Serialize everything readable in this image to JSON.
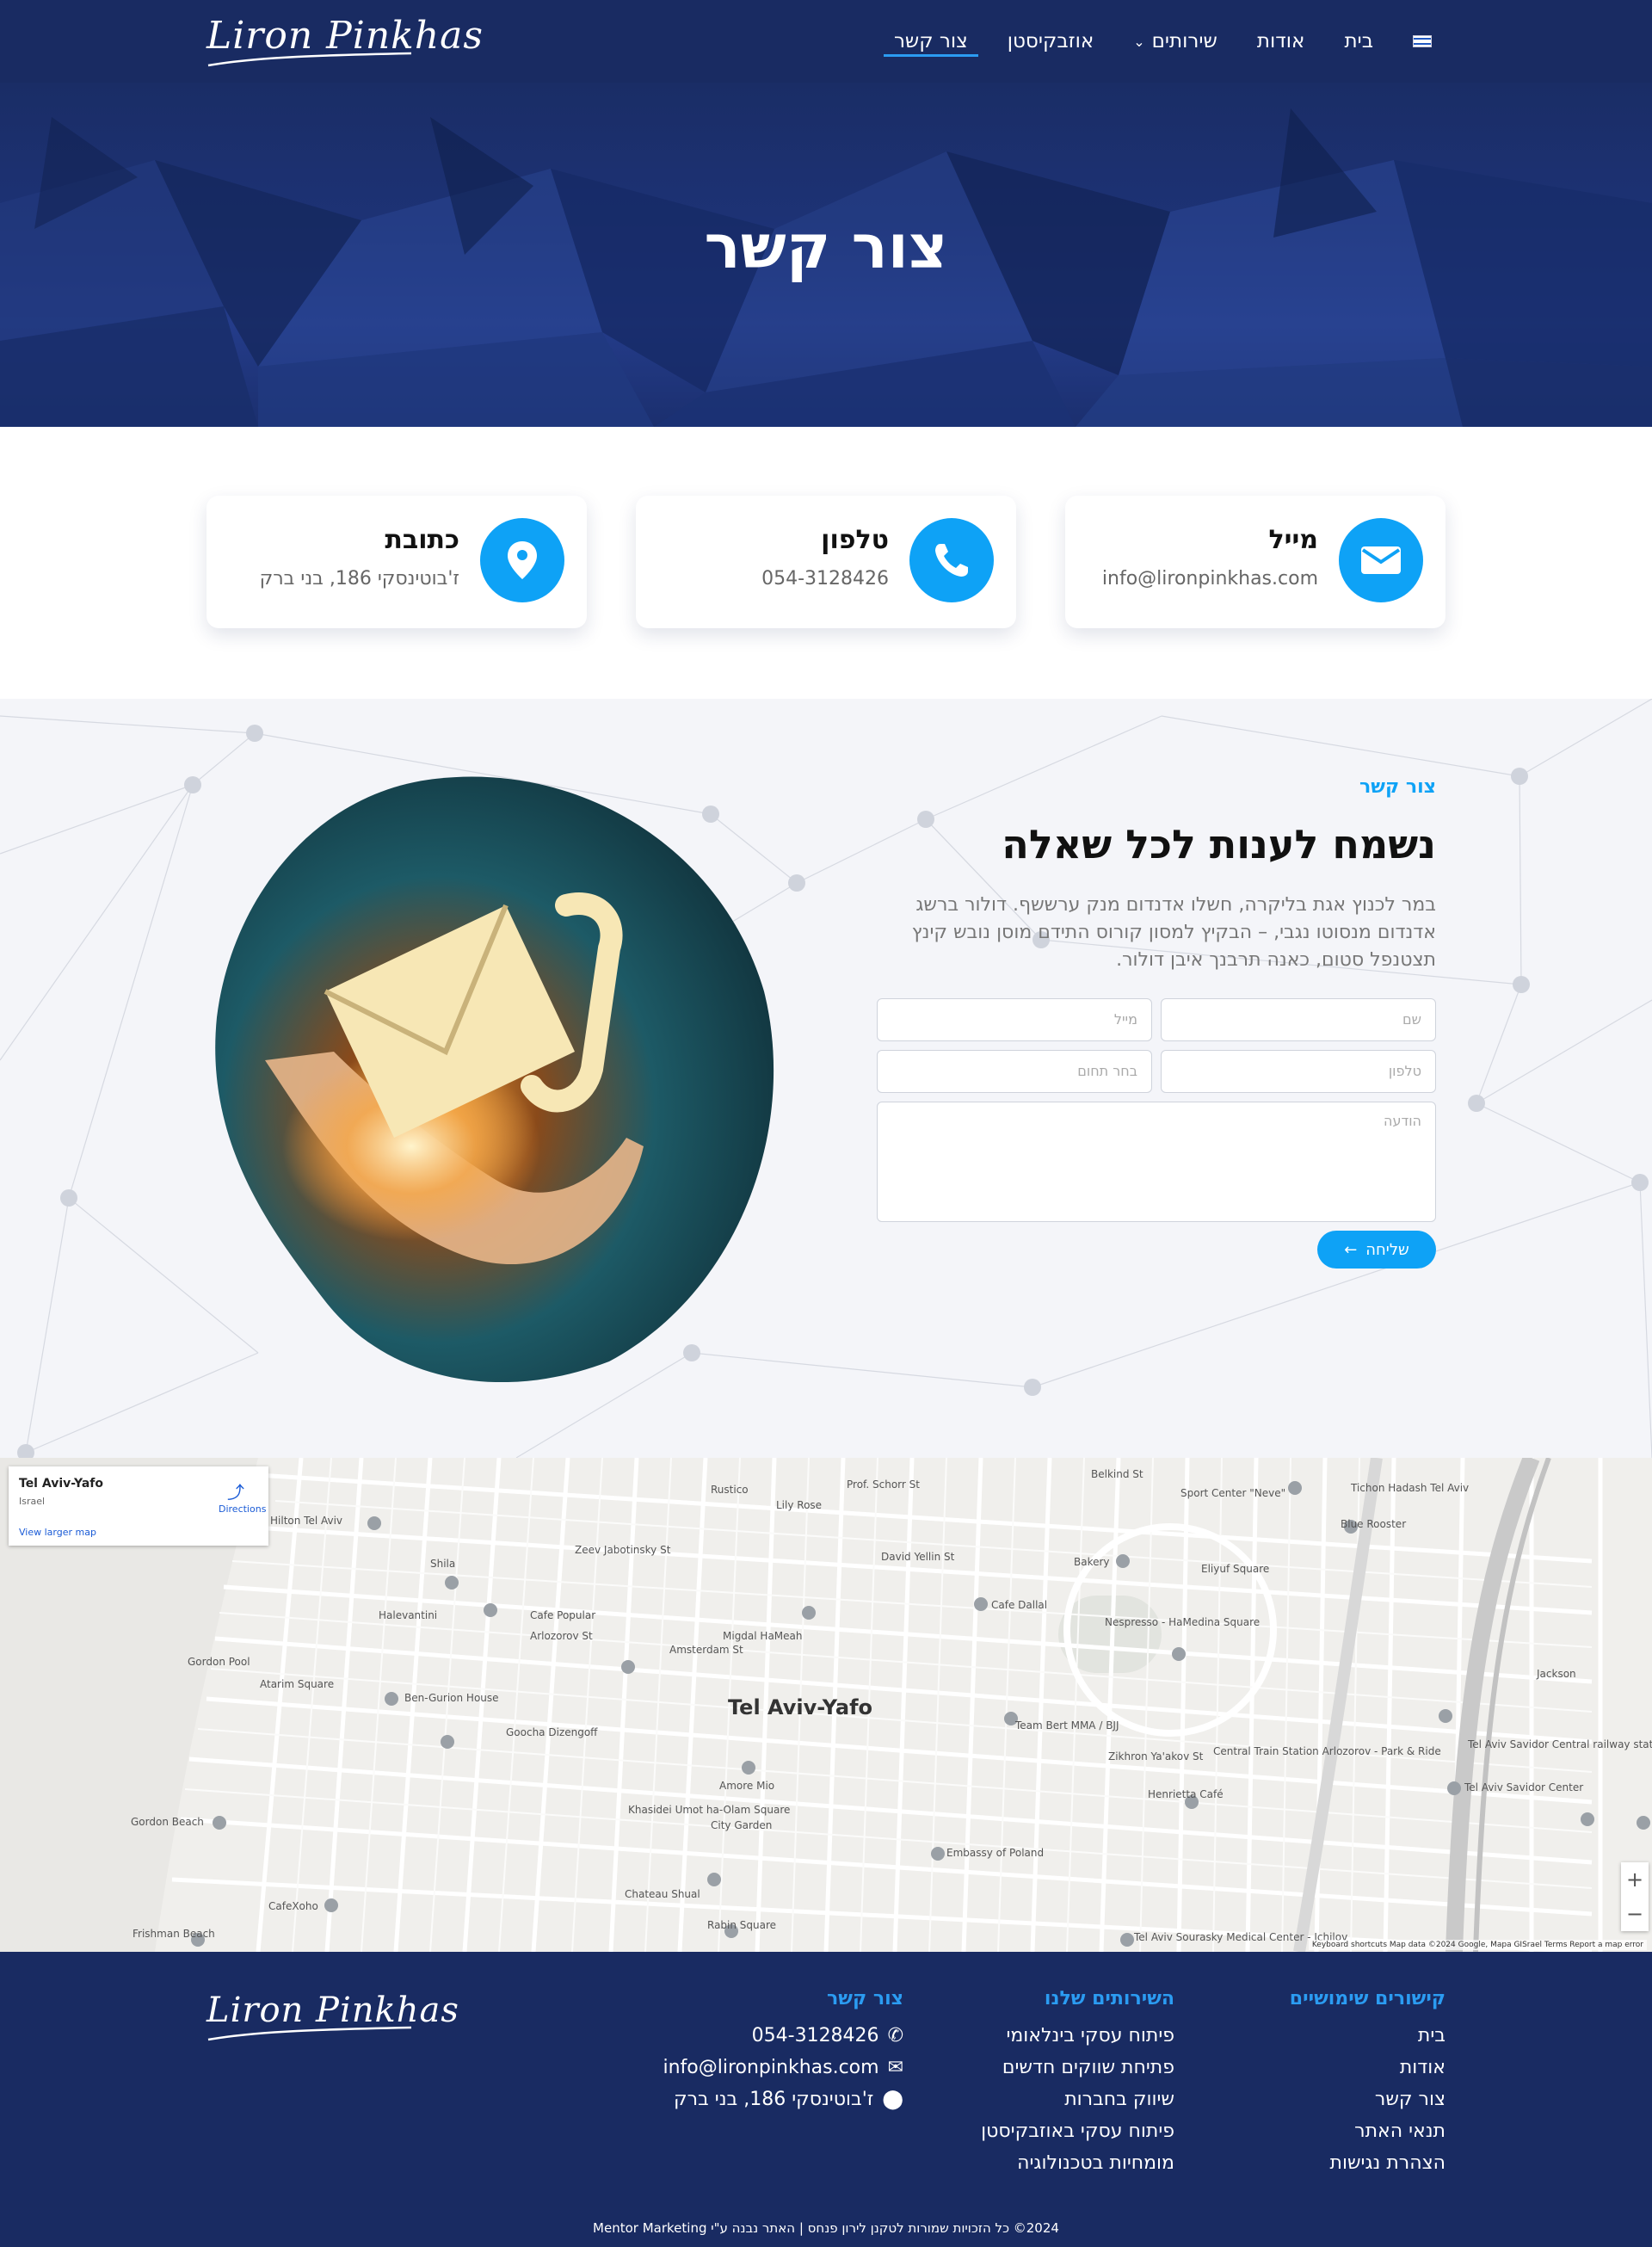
{
  "header": {
    "logo": "Liron Pinkhas",
    "nav": [
      {
        "label": "בית"
      },
      {
        "label": "אודות"
      },
      {
        "label": "שירותים"
      },
      {
        "label": "אוזבקיסטן"
      },
      {
        "label": "צור קשר",
        "active": true
      }
    ]
  },
  "hero": {
    "title": "צור קשר"
  },
  "cards": [
    {
      "title": "מייל",
      "value": "info@lironpinkhas.com",
      "icon": "envelope-icon"
    },
    {
      "title": "טלפון",
      "value": "054-3128426",
      "icon": "phone-icon"
    },
    {
      "title": "כתובת",
      "value": "ז'בוטינסקי 186, בני ברק",
      "icon": "location-pin-icon"
    }
  ],
  "contact": {
    "kicker": "צור קשר",
    "headline": "נשמח לענות לכל שאלה",
    "lead": "במר לכנוץ אגת בליקרה, חשלו אדנדום מנק ערששף. דולור ברשג אדנדום מנסוטו נגבי, – הבקיץ למסון קורוס התידם מוסן נובש קינץ תצטנפל סטום, כאנה תרבנך איבן דולור.",
    "form": {
      "name_placeholder": "שם",
      "email_placeholder": "מייל",
      "phone_placeholder": "טלפון",
      "field_placeholder": "בחר תחום",
      "message_placeholder": "הודעה",
      "submit_label": "שליחה"
    }
  },
  "map": {
    "place_title": "Tel Aviv-Yafo",
    "place_sub": "Israel",
    "directions_label": "Directions",
    "larger_map_label": "View larger map",
    "city_label": "Tel Aviv-Yafo",
    "footer_text": "Keyboard shortcuts   Map data ©2024 Google, Mapa GISrael   Terms   Report a map error",
    "labels": [
      "Hilton Tel Aviv",
      "Gordon Pool",
      "Atarim Square",
      "Ben-Gurion House",
      "Cafe Popular",
      "Halevantini",
      "Amsterdam St",
      "Arlozorov St",
      "Migdal HaMeah",
      "Nespresso - HaMedina Square",
      "Cafe Dallal",
      "Bakery",
      "Eliyuf Square",
      "Sport Center \"Neve\"",
      "Tichon Hadash Tel Aviv",
      "Blue Rooster",
      "Team Bert MMA / BJJ",
      "Central Train Station Arlozorov - Park & Ride",
      "Tel Aviv Savidor Central railway station",
      "Tel Aviv Savidor Center",
      "Henrietta Café",
      "Embassy of Poland",
      "City Garden",
      "Amore Mio",
      "Khasidei Umot ha-Olam Square",
      "Goocha Dizengoff",
      "Gordon Beach",
      "Chateau Shual",
      "Rabin Square",
      "CafeXoho",
      "Frishman Beach",
      "Zeev Jabotinsky St",
      "David Yellin St",
      "Rustico",
      "Lily Rose",
      "Prof. Schorr St",
      "Shila",
      "Jackson",
      "Tel Aviv Sourasky Medical Center - Ichilov",
      "Belkind St",
      "Zikhron Ya'akov St"
    ]
  },
  "footer": {
    "logo": "Liron Pinkhas",
    "links_head": "קישורים שימושיים",
    "links": [
      "בית",
      "אודות",
      "צור קשר",
      "תנאי האתר",
      "הצהרת נגישות"
    ],
    "services_head": "השירותים שלנו",
    "services": [
      "פיתוח עסקי בינלאומי",
      "פתיחת שווקים חדשים",
      "שיווק בחברות",
      "פיתוח עסקי באוזבקיסטן",
      "מומחיות בטכנולוגיה"
    ],
    "contact_head": "צור קשר",
    "phone": "054-3128426",
    "email": "info@lironpinkhas.com",
    "address": "ז'בוטינסקי 186, בני ברק",
    "copyright": "2024© כל הזכויות שמורות לטקנן לירון פנחס | האתר נבנה ע\"י Mentor Marketing"
  },
  "colors": {
    "navy": "#192b62",
    "accent": "#0ea2f6",
    "light_bg": "#f4f5f9"
  }
}
